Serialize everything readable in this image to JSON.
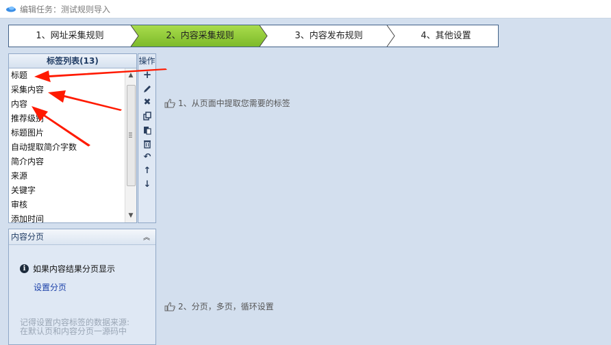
{
  "window": {
    "title": "编辑任务：测试规则导入"
  },
  "wizard": {
    "steps": [
      {
        "label": "1、网址采集规则"
      },
      {
        "label": "2、内容采集规则"
      },
      {
        "label": "3、内容发布规则"
      },
      {
        "label": "4、其他设置"
      }
    ],
    "active_step": 2
  },
  "tag_panel": {
    "header": "标签列表(13)",
    "items": [
      "标题",
      "采集内容",
      "内容",
      "推荐级别",
      "标题图片",
      "自动提取简介字数",
      "简介内容",
      "来源",
      "关键字",
      "审核",
      "添加时间"
    ]
  },
  "ops_panel": {
    "header": "操作",
    "buttons": [
      "plus-icon",
      "pencil-icon",
      "delete-icon",
      "copy-icon",
      "paste-icon",
      "trash-icon",
      "undo-icon",
      "arrow-up-icon",
      "arrow-down-icon"
    ]
  },
  "paging_panel": {
    "header": "内容分页",
    "info": "如果内容结果分页显示",
    "link": "设置分页",
    "note_line1": "记得设置内容标签的数据来源:",
    "note_line2": "在默认页和内容分页一源码中"
  },
  "hints": {
    "hint1": "1、从页面中提取您需要的标签",
    "hint2": "2、分页，多页，循环设置"
  },
  "colors": {
    "active_step": "#8cc832",
    "annotation_arrow": "#ff1a00",
    "background": "#d3dfee"
  }
}
